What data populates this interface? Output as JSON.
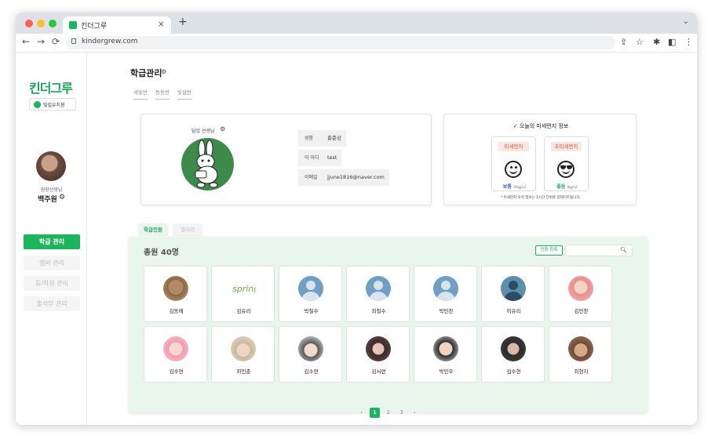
{
  "browser": {
    "tab_title": "킨더그루",
    "tab_close": "×",
    "new_tab": "+",
    "tab_menu": "⌄",
    "url": "kindergrew.com",
    "nav": {
      "back": "←",
      "forward": "→",
      "reload": "⟳"
    },
    "toolbar_icons": [
      "share-icon",
      "star-icon",
      "extensions-icon",
      "sidepanel-icon",
      "kebab-menu-icon"
    ]
  },
  "sidebar": {
    "logo": "킨더그루",
    "school": "빛설유치원",
    "role": "원장선생님",
    "username": "백주원",
    "menu": [
      {
        "label": "학급 관리",
        "active": true
      },
      {
        "label": "멤버 관리",
        "active": false
      },
      {
        "label": "등/하원 관리",
        "active": false
      },
      {
        "label": "출석부 관리",
        "active": false
      }
    ]
  },
  "main": {
    "title": "학급관리",
    "class_tabs": [
      "새빛반",
      "동동반",
      "빛살반"
    ],
    "teacher": {
      "label": "담임 선생님",
      "info": [
        {
          "label": "성함",
          "value": "홍준상"
        },
        {
          "label": "아 이디",
          "value": "test"
        },
        {
          "label": "이메일",
          "value": "jjune1816@naver.com"
        }
      ]
    },
    "dust": {
      "title": "오늘의 미세먼지 정보",
      "items": [
        {
          "label": "미세먼지",
          "status": "보통",
          "unit": "50㎍/㎥",
          "status_color": "#2b59c3",
          "face": "smile-icon"
        },
        {
          "label": "초미세먼지",
          "status": "좋음",
          "unit": "9㎍/㎥",
          "status_color": "#1ea15a",
          "face": "sunglasses-icon"
        }
      ],
      "note": "* 미세먼지 수치 정보는 1시간 단위로 업데이트됩니다."
    },
    "section_tabs": [
      "학급인원",
      "갤러리"
    ],
    "total": "총원 40명",
    "add_button": "인원 등록",
    "search_placeholder": "",
    "members": [
      {
        "name": "김동에",
        "avatar": "dog"
      },
      {
        "name": "김유리",
        "avatar": "spring-logo"
      },
      {
        "name": "박철수",
        "avatar": "default"
      },
      {
        "name": "최철수",
        "avatar": "default"
      },
      {
        "name": "박민찬",
        "avatar": "default"
      },
      {
        "name": "이유리",
        "avatar": "default-dark"
      },
      {
        "name": "김민찬",
        "avatar": "kid-pink"
      },
      {
        "name": "김수연",
        "avatar": "kid-pink2"
      },
      {
        "name": "최민준",
        "avatar": "kid-cap"
      },
      {
        "name": "김소연",
        "avatar": "kid-light"
      },
      {
        "name": "김서연",
        "avatar": "kid-dark"
      },
      {
        "name": "박민우",
        "avatar": "kid-boy"
      },
      {
        "name": "김수현",
        "avatar": "kid-dark2"
      },
      {
        "name": "최현지",
        "avatar": "kid-group"
      }
    ],
    "pagination": {
      "prev": "‹",
      "pages": [
        "1",
        "2",
        "3"
      ],
      "next": "›",
      "current": "1"
    }
  }
}
